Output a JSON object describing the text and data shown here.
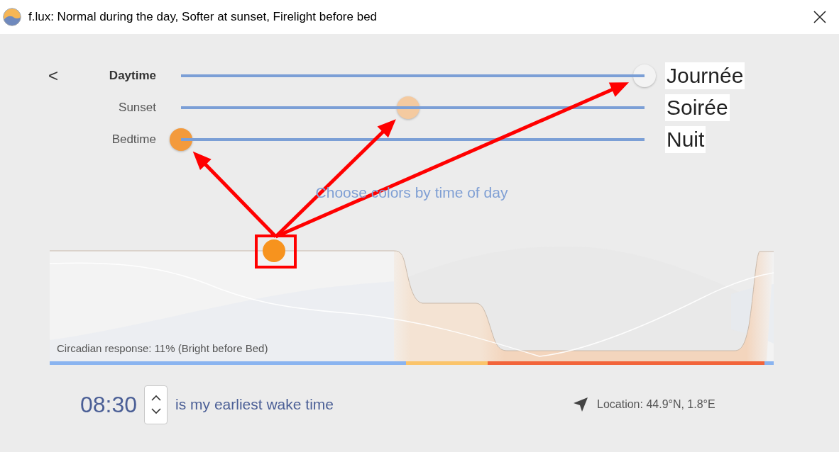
{
  "window": {
    "title": "f.lux: Normal during the day, Softer at sunset, Firelight before bed"
  },
  "back_button": "<",
  "sliders": [
    {
      "label": "Daytime",
      "selected": true,
      "level": 1,
      "color": "#f3f3f3",
      "annotation": "Journée"
    },
    {
      "label": "Sunset",
      "selected": false,
      "level": 0.49,
      "color": "#f4caa0",
      "annotation": "Soirée"
    },
    {
      "label": "Bedtime",
      "selected": false,
      "level": 0,
      "color": "#f39a3c",
      "annotation": "Nuit"
    }
  ],
  "heading": "Choose colors by time of day",
  "chart": {
    "caption": "Circadian response: 11% (Bright before Bed)",
    "marker_highlighted": true
  },
  "wake_time": {
    "value": "08:30",
    "label": "is my earliest wake time"
  },
  "location": "Location: 44.9°N, 1.8°E"
}
